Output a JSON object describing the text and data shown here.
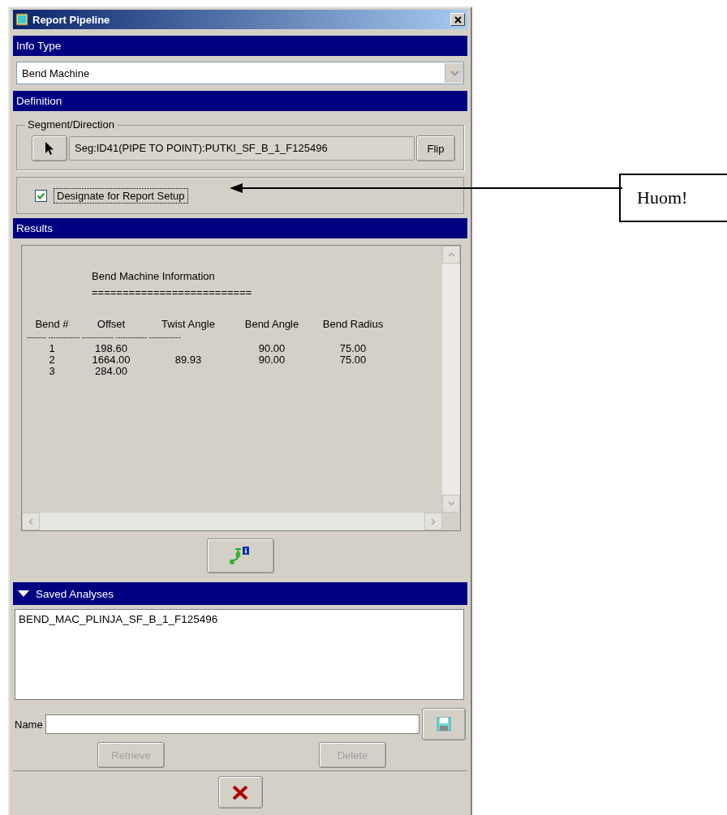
{
  "window": {
    "title": "Report Pipeline"
  },
  "info_type": {
    "header": "Info Type",
    "value": "Bend Machine"
  },
  "definition": {
    "header": "Definition",
    "group_label": "Segment/Direction",
    "segment": "Seg:ID41(PIPE TO POINT):PUTKI_SF_B_1_F125496",
    "flip_button": "Flip",
    "designate": {
      "label": "Designate for Report Setup",
      "checked": true
    }
  },
  "results": {
    "header": "Results",
    "title": "Bend Machine Information",
    "underline": "==========================",
    "columns": [
      "Bend #",
      "Offset",
      "Twist Angle",
      "Bend Angle",
      "Bend Radius"
    ],
    "separator": "-------- ------------- ------------- ------------- -------------",
    "rows": [
      {
        "cells": [
          "1",
          "198.60",
          null,
          "90.00",
          "75.00"
        ]
      },
      {
        "cells": [
          "2",
          "1664.00",
          "89.93",
          "90.00",
          "75.00"
        ]
      },
      {
        "cells": [
          "3",
          "284.00",
          null,
          null,
          null
        ]
      }
    ]
  },
  "saved": {
    "header": "Saved Analyses",
    "expanded": true,
    "items": [
      {
        "label": "BEND_MAC_PLINJA_SF_B_1_F125496",
        "selected": false
      }
    ],
    "name_label": "Name",
    "retrieve": {
      "label": "Retrieve",
      "disabled": true
    },
    "delete": {
      "label": "Delete",
      "disabled": true
    }
  },
  "annotation": {
    "text": "Huom!"
  }
}
